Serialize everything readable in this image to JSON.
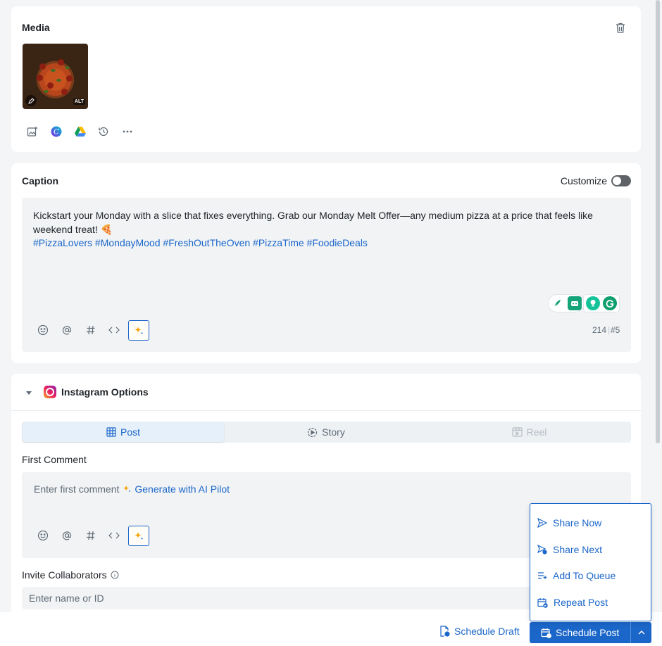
{
  "media": {
    "title": "Media",
    "thumb_alt_badge": "ALT",
    "tools": [
      "add-image-icon",
      "canva-icon",
      "google-drive-icon",
      "history-icon",
      "more-icon"
    ]
  },
  "caption": {
    "title": "Caption",
    "customize_label": "Customize",
    "text_line1": "Kickstart your Monday with a slice that fixes everything. Grab our Monday Melt Offer—any medium pizza at a price that feels like",
    "text_line2": "weekend treat! 🍕",
    "hashtags": "#PizzaLovers #MondayMood #FreshOutTheOven #PizzaTime #FoodieDeals",
    "char_count": "214",
    "hashtag_count": "#5"
  },
  "instagram": {
    "title": "Instagram Options",
    "tabs": [
      {
        "label": "Post",
        "state": "active"
      },
      {
        "label": "Story",
        "state": "normal"
      },
      {
        "label": "Reel",
        "state": "disabled"
      }
    ],
    "first_comment": {
      "label": "First Comment",
      "placeholder": "Enter first comment",
      "ai_link": "Generate with AI Pilot"
    },
    "collaborators": {
      "label": "Invite Collaborators",
      "placeholder": "Enter name or ID"
    }
  },
  "menu": {
    "items": [
      "Share Now",
      "Share Next",
      "Add To Queue",
      "Repeat Post"
    ]
  },
  "footer": {
    "draft_label": "Schedule Draft",
    "schedule_label": "Schedule Post"
  },
  "colors": {
    "accent": "#1b66c9",
    "grammarly": "#15c39a"
  }
}
